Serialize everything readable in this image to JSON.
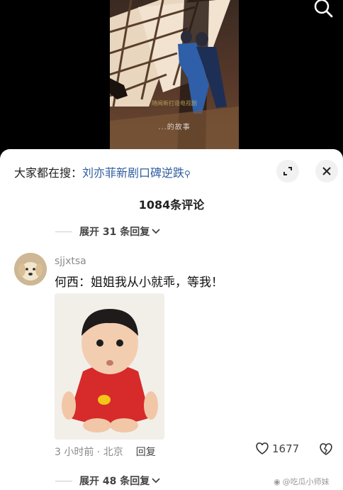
{
  "video": {
    "subtitle": "...的故事",
    "overlay": "随闻新打造电视剧"
  },
  "header": {
    "hot_search_prefix": "大家都在搜：",
    "hot_search_term": "刘亦菲新剧口碑逆跌"
  },
  "comments": {
    "count_title": "1084条评论",
    "expand_top": "展开 31 条回复",
    "expand_bottom": "展开 48 条回复",
    "item": {
      "username": "sjjxtsa",
      "text": "何西：姐姐我从小就乖，等我！",
      "time_location": "3 小时前 · 北京",
      "reply_label": "回复",
      "likes": "1677"
    }
  },
  "watermark": "@吃瓜小师妹",
  "icons": {
    "search": "search-icon",
    "expand": "expand-icon",
    "close": "close-icon",
    "chevron": "chevron-down-icon",
    "heart": "heart-icon",
    "dislike": "broken-heart-icon"
  },
  "colors": {
    "link": "#2f5d9e",
    "sheet_bg": "#ffffff"
  }
}
